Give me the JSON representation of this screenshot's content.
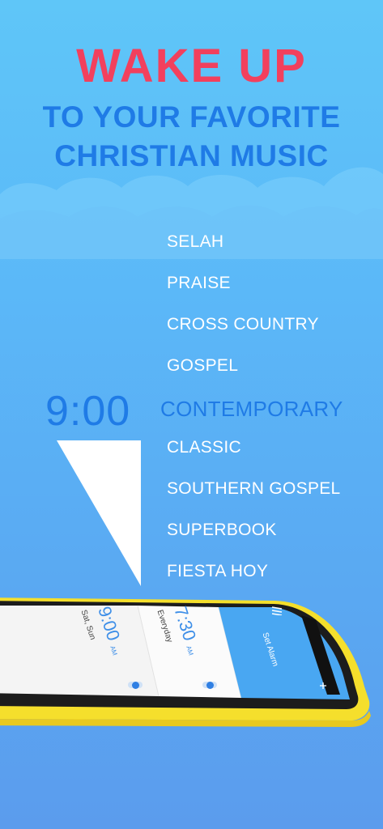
{
  "headline": {
    "main": "WAKE UP",
    "sub_line1": "TO YOUR FAVORITE",
    "sub_line2": "CHRISTIAN MUSIC"
  },
  "clock": {
    "time": "9:00"
  },
  "stations": [
    "SELAH",
    "PRAISE",
    "CROSS COUNTRY",
    "GOSPEL",
    "CONTEMPORARY",
    "CLASSIC",
    "SOUTHERN GOSPEL",
    "SUPERBOOK",
    "FIESTA HOY"
  ],
  "selected_station": "CONTEMPORARY",
  "phone": {
    "alarms": [
      {
        "time": "9:00",
        "ampm": "AM",
        "days": "Sat, Sun"
      },
      {
        "time": "7:30",
        "ampm": "AM",
        "days": "Everyday"
      }
    ],
    "header_title": "Set Alarm"
  },
  "colors": {
    "headline_red": "#f2405d",
    "accent_blue": "#1f7be6",
    "phone_frame": "#f7e234"
  }
}
